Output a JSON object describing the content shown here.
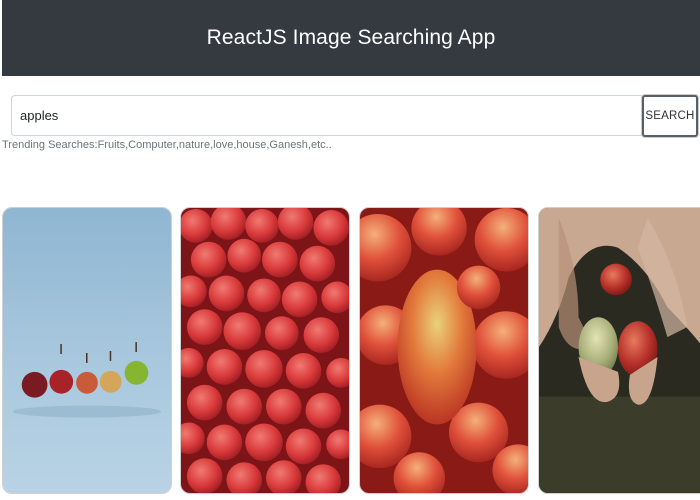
{
  "header": {
    "title": "ReactJS Image Searching App"
  },
  "search": {
    "value": "apples",
    "button_label": "SEARCH"
  },
  "trending": {
    "text": "Trending Searches:Fruits,Computer,nature,love,house,Ganesh,etc.."
  },
  "results": [
    {
      "name": "apples-in-a-row-photo"
    },
    {
      "name": "pile-of-red-apples-photo"
    },
    {
      "name": "apples-closeup-photo"
    },
    {
      "name": "hands-holding-apples-photo"
    }
  ],
  "colors": {
    "header_bg": "#343a40",
    "header_text": "#ffffff",
    "muted_text": "#6c757d"
  }
}
